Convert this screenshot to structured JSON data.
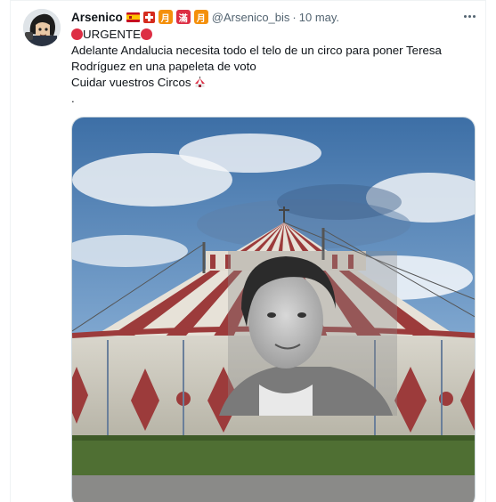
{
  "tweet": {
    "display_name": "Arsenico",
    "name_emojis": [
      "flag-spain",
      "flag-switzerland",
      "月",
      "滿",
      "月"
    ],
    "handle": "@Arsenico_bis",
    "separator": "·",
    "date": "10 may.",
    "more_label": "More",
    "text": {
      "line1_word": "URGENTE",
      "line2": "Adelante Andalucia necesita todo el telo de un circo para poner Teresa",
      "line3": "Rodríguez en una papeleta de voto",
      "line4": "Cuidar vuestros Circos",
      "line5": "."
    },
    "media": {
      "subject": "photo-circus-tent-with-face"
    }
  },
  "colors": {
    "name": "#0f1419",
    "secondary": "#536471",
    "border": "#cfd9de",
    "red_circle": "#dd2e44",
    "kanji_orange": "#f4900c",
    "kanji_red": "#dd2e44"
  }
}
